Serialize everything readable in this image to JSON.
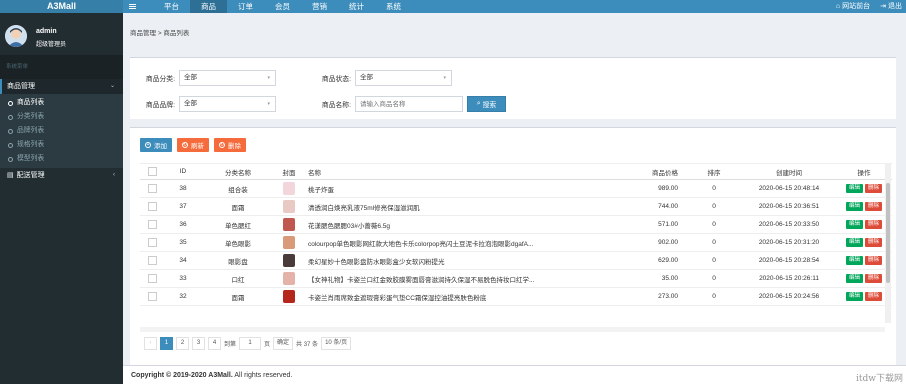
{
  "app": {
    "logo": "A3Mall"
  },
  "topnav": {
    "items": [
      {
        "label": "平台",
        "active": false
      },
      {
        "label": "商品",
        "active": true
      },
      {
        "label": "订单",
        "active": false
      },
      {
        "label": "会员",
        "active": false
      },
      {
        "label": "营销",
        "active": false
      },
      {
        "label": "统计",
        "active": false
      },
      {
        "label": "系统",
        "active": false
      }
    ],
    "home_label": "网站前台",
    "logout_label": "退出"
  },
  "user": {
    "name": "admin",
    "role": "超级管理员"
  },
  "sidebar": {
    "section_title": "系统菜单",
    "groups": [
      {
        "label": "商品管理"
      },
      {
        "label": "配送管理"
      }
    ],
    "items": [
      {
        "label": "商品列表",
        "active": true
      },
      {
        "label": "分类列表",
        "active": false
      },
      {
        "label": "品牌列表",
        "active": false
      },
      {
        "label": "规格列表",
        "active": false
      },
      {
        "label": "模型列表",
        "active": false
      }
    ]
  },
  "breadcrumb": {
    "parent": "商品管理",
    "sep": ">",
    "current": "商品列表"
  },
  "filters": {
    "category_label": "商品分类:",
    "category_value": "全部",
    "status_label": "商品状态:",
    "status_value": "全部",
    "brand_label": "商品品牌:",
    "brand_value": "全部",
    "name_label": "商品名称:",
    "name_placeholder": "请输入商品名称",
    "search_label": "搜索"
  },
  "toolbar": {
    "add": "添加",
    "refresh": "刷新",
    "delete": "删除"
  },
  "table": {
    "headers": [
      "",
      "ID",
      "分类名称",
      "封面",
      "名称",
      "商品价格",
      "排序",
      "创建时间",
      "操作"
    ],
    "rows": [
      {
        "id": "38",
        "category": "组合装",
        "name": "桃子炸蛋",
        "price": "989.00",
        "sort": "0",
        "created": "2020-06-15 20:48:14",
        "thumb_color": "#f3d6dc"
      },
      {
        "id": "37",
        "category": "面霜",
        "name": "清透润白焕亮乳液75ml修亮保湿滋润肌",
        "price": "744.00",
        "sort": "0",
        "created": "2020-06-15 20:36:51",
        "thumb_color": "#e8c9c4"
      },
      {
        "id": "36",
        "category": "单色腮红",
        "name": "花漾腮色腮腮03#小蔷薇6.5g",
        "price": "571.00",
        "sort": "0",
        "created": "2020-06-15 20:33:50",
        "thumb_color": "#c0584f"
      },
      {
        "id": "35",
        "category": "单色眼影",
        "name": "colourpop单色眼影网红款大地色卡乐colorpop亮闪土豆泥卡拉泡泡眼影dgafA...",
        "price": "902.00",
        "sort": "0",
        "created": "2020-06-15 20:31:20",
        "thumb_color": "#d99a7a"
      },
      {
        "id": "34",
        "category": "眼影盘",
        "name": "柔幻星妙十色眼影盘防水眼影盒少女软闪粉提光",
        "price": "629.00",
        "sort": "0",
        "created": "2020-06-15 20:28:54",
        "thumb_color": "#4a3b3b"
      },
      {
        "id": "33",
        "category": "口红",
        "name": "【女神礼物】卡姿兰口红金致胶膜雾面唇膏滋润持久保湿不易脱色持妆口红学...",
        "price": "35.00",
        "sort": "0",
        "created": "2020-06-15 20:26:11",
        "thumb_color": "#e4b2a8"
      },
      {
        "id": "32",
        "category": "面霜",
        "name": "卡姿兰肖雨席致金遮瑕膏彩蛋气垫CC霜保湿控油提亮肤色粉底",
        "price": "273.00",
        "sort": "0",
        "created": "2020-06-15 20:24:56",
        "thumb_color": "#b5261d"
      }
    ],
    "edit_label": "编辑",
    "delete_label": "删除"
  },
  "pager": {
    "prev": "‹",
    "pages": [
      "1",
      "2",
      "3",
      "4"
    ],
    "current": "1",
    "goto_label": "到第",
    "goto_value": "1",
    "page_unit": "页",
    "confirm": "确定",
    "total": "共 37 条",
    "per_page": "10 条/页"
  },
  "footer": {
    "copyright": "Copyright © 2019-2020 A3Mall.",
    "rights": "All rights reserved."
  },
  "watermark": "itdw下载网",
  "colors": {
    "topbar": "#3c8dbc",
    "sidebar": "#222d32",
    "edit": "#00a65a",
    "delete": "#dd4b39",
    "refresh": "#f56b3b"
  }
}
